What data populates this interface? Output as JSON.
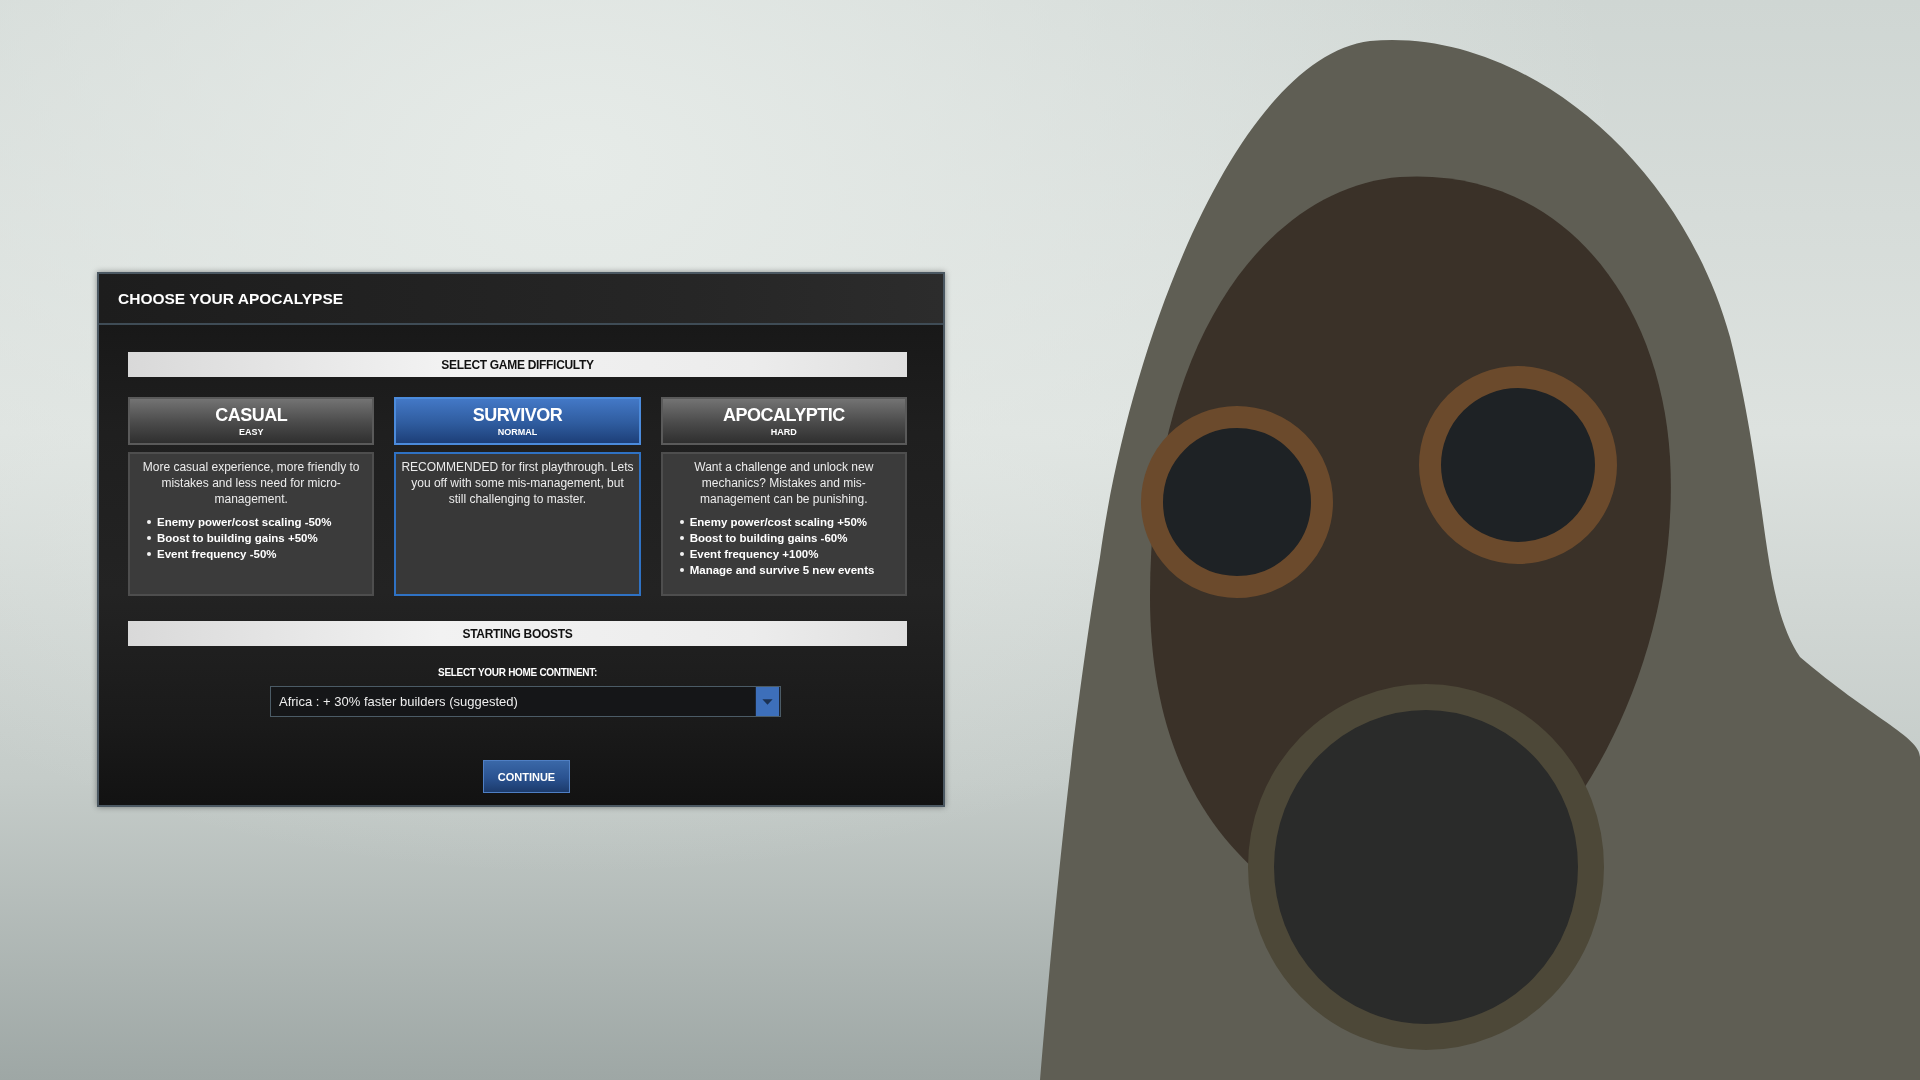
{
  "dialog": {
    "title": "CHOOSE YOUR APOCALYPSE",
    "difficulty": {
      "heading": "SELECT GAME DIFFICULTY",
      "options": [
        {
          "name": "CASUAL",
          "tier": "EASY",
          "selected": false,
          "description": "More casual experience, more friendly to mistakes and less need for micro-management.",
          "effects": [
            "Enemy power/cost scaling -50%",
            "Boost to building gains +50%",
            "Event frequency -50%"
          ]
        },
        {
          "name": "SURVIVOR",
          "tier": "NORMAL",
          "selected": true,
          "description": "RECOMMENDED for first playthrough. Lets you off with some mis-management, but still challenging to master."
        },
        {
          "name": "APOCALYPTIC",
          "tier": "HARD",
          "selected": false,
          "description": "Want a challenge and unlock new mechanics? Mistakes and mis-management can be punishing.",
          "effects": [
            "Enemy power/cost scaling +50%",
            "Boost to building gains -60%",
            "Event frequency +100%",
            "Manage and survive 5 new events"
          ]
        }
      ]
    },
    "boosts": {
      "heading": "STARTING BOOSTS",
      "label": "SELECT YOUR HOME CONTINENT:",
      "continent_dropdown": {
        "value": "Africa : + 30% faster builders (suggested)"
      }
    },
    "continue_button": {
      "label": "CONTINUE"
    }
  }
}
